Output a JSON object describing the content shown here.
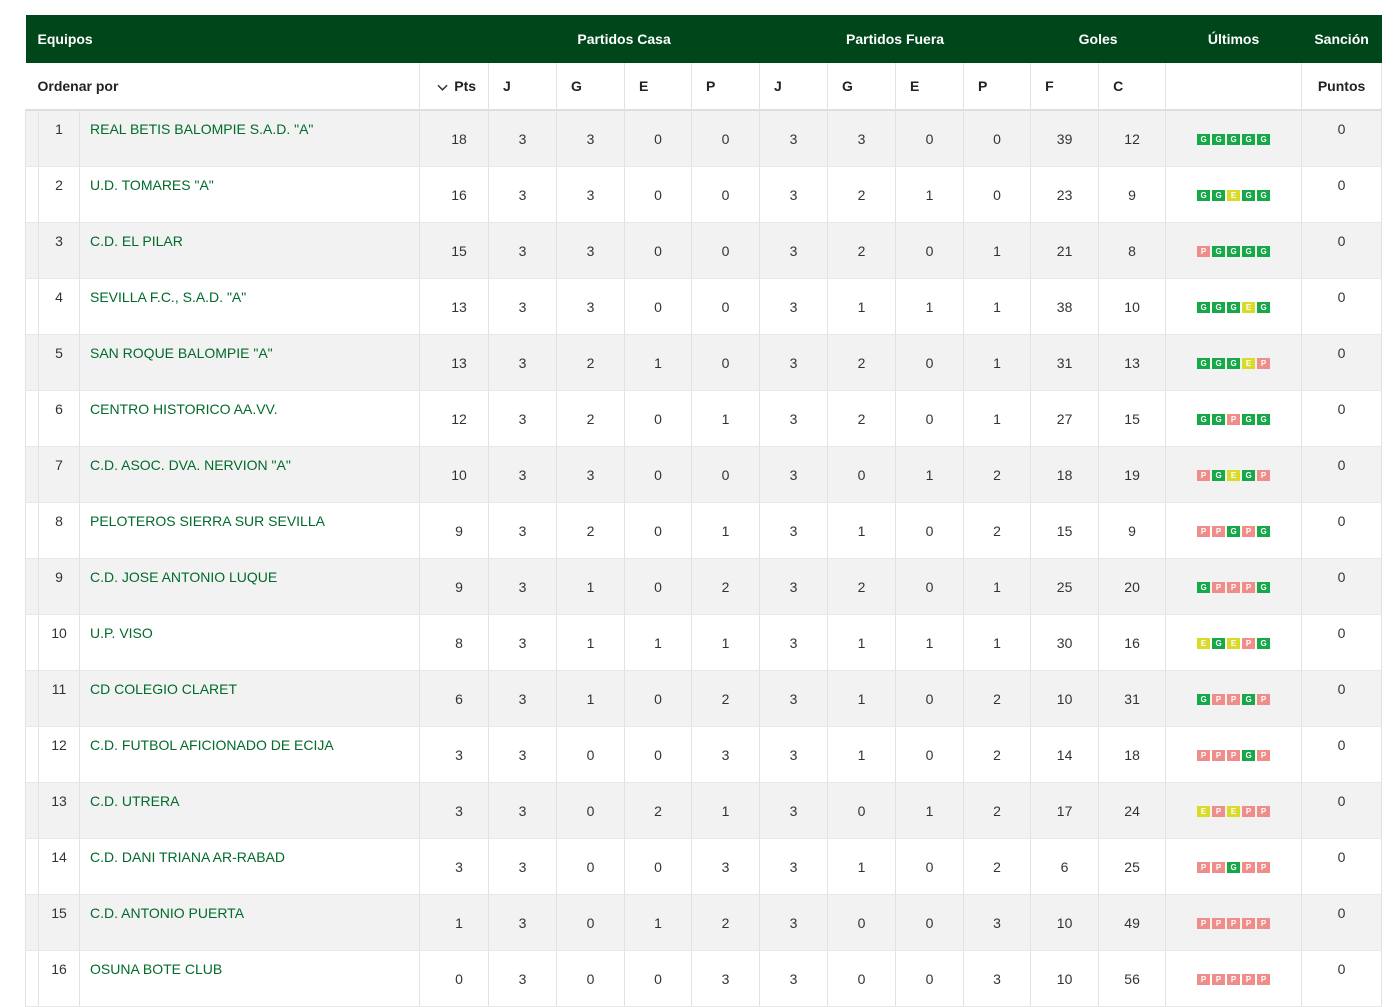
{
  "header": {
    "equipos": "Equipos",
    "partidos_casa": "Partidos Casa",
    "partidos_fuera": "Partidos Fuera",
    "goles": "Goles",
    "ultimos": "Últimos",
    "sancion": "Sanción"
  },
  "subheader": {
    "ordenar_por": "Ordenar por",
    "pts": "Pts",
    "home_j": "J",
    "home_g": "G",
    "home_e": "E",
    "home_p": "P",
    "away_j": "J",
    "away_g": "G",
    "away_e": "E",
    "away_p": "P",
    "goles_f": "F",
    "goles_c": "C",
    "puntos": "Puntos"
  },
  "colors": {
    "header_bg": "#00461b",
    "team_link": "#006b2a",
    "win": "#17a84a",
    "draw": "#d8db2a",
    "loss": "#ef8d8a"
  },
  "icons": {
    "sort": "chevron-down-icon"
  },
  "rows": [
    {
      "pos": "1",
      "team": "REAL BETIS BALOMPIE S.A.D. \"A\"",
      "pts": "18",
      "hj": "3",
      "hg": "3",
      "he": "0",
      "hp": "0",
      "aj": "3",
      "ag": "3",
      "ae": "0",
      "ap": "0",
      "gf": "39",
      "gc": "12",
      "form": [
        "G",
        "G",
        "G",
        "G",
        "G"
      ],
      "sancion": "0"
    },
    {
      "pos": "2",
      "team": "U.D. TOMARES \"A\"",
      "pts": "16",
      "hj": "3",
      "hg": "3",
      "he": "0",
      "hp": "0",
      "aj": "3",
      "ag": "2",
      "ae": "1",
      "ap": "0",
      "gf": "23",
      "gc": "9",
      "form": [
        "G",
        "G",
        "E",
        "G",
        "G"
      ],
      "sancion": "0"
    },
    {
      "pos": "3",
      "team": "C.D. EL PILAR",
      "pts": "15",
      "hj": "3",
      "hg": "3",
      "he": "0",
      "hp": "0",
      "aj": "3",
      "ag": "2",
      "ae": "0",
      "ap": "1",
      "gf": "21",
      "gc": "8",
      "form": [
        "P",
        "G",
        "G",
        "G",
        "G"
      ],
      "sancion": "0"
    },
    {
      "pos": "4",
      "team": "SEVILLA F.C., S.A.D. \"A\"",
      "pts": "13",
      "hj": "3",
      "hg": "3",
      "he": "0",
      "hp": "0",
      "aj": "3",
      "ag": "1",
      "ae": "1",
      "ap": "1",
      "gf": "38",
      "gc": "10",
      "form": [
        "G",
        "G",
        "G",
        "E",
        "G"
      ],
      "sancion": "0"
    },
    {
      "pos": "5",
      "team": "SAN ROQUE BALOMPIE \"A\"",
      "pts": "13",
      "hj": "3",
      "hg": "2",
      "he": "1",
      "hp": "0",
      "aj": "3",
      "ag": "2",
      "ae": "0",
      "ap": "1",
      "gf": "31",
      "gc": "13",
      "form": [
        "G",
        "G",
        "G",
        "E",
        "P"
      ],
      "sancion": "0"
    },
    {
      "pos": "6",
      "team": "CENTRO HISTORICO AA.VV.",
      "pts": "12",
      "hj": "3",
      "hg": "2",
      "he": "0",
      "hp": "1",
      "aj": "3",
      "ag": "2",
      "ae": "0",
      "ap": "1",
      "gf": "27",
      "gc": "15",
      "form": [
        "G",
        "G",
        "P",
        "G",
        "G"
      ],
      "sancion": "0"
    },
    {
      "pos": "7",
      "team": "C.D. ASOC. DVA. NERVION \"A\"",
      "pts": "10",
      "hj": "3",
      "hg": "3",
      "he": "0",
      "hp": "0",
      "aj": "3",
      "ag": "0",
      "ae": "1",
      "ap": "2",
      "gf": "18",
      "gc": "19",
      "form": [
        "P",
        "G",
        "E",
        "G",
        "P"
      ],
      "sancion": "0"
    },
    {
      "pos": "8",
      "team": "PELOTEROS SIERRA SUR SEVILLA",
      "pts": "9",
      "hj": "3",
      "hg": "2",
      "he": "0",
      "hp": "1",
      "aj": "3",
      "ag": "1",
      "ae": "0",
      "ap": "2",
      "gf": "15",
      "gc": "9",
      "form": [
        "P",
        "P",
        "G",
        "P",
        "G"
      ],
      "sancion": "0"
    },
    {
      "pos": "9",
      "team": "C.D. JOSE ANTONIO LUQUE",
      "pts": "9",
      "hj": "3",
      "hg": "1",
      "he": "0",
      "hp": "2",
      "aj": "3",
      "ag": "2",
      "ae": "0",
      "ap": "1",
      "gf": "25",
      "gc": "20",
      "form": [
        "G",
        "P",
        "P",
        "P",
        "G"
      ],
      "sancion": "0"
    },
    {
      "pos": "10",
      "team": "U.P. VISO",
      "pts": "8",
      "hj": "3",
      "hg": "1",
      "he": "1",
      "hp": "1",
      "aj": "3",
      "ag": "1",
      "ae": "1",
      "ap": "1",
      "gf": "30",
      "gc": "16",
      "form": [
        "E",
        "G",
        "E",
        "P",
        "G"
      ],
      "sancion": "0"
    },
    {
      "pos": "11",
      "team": "CD COLEGIO CLARET",
      "pts": "6",
      "hj": "3",
      "hg": "1",
      "he": "0",
      "hp": "2",
      "aj": "3",
      "ag": "1",
      "ae": "0",
      "ap": "2",
      "gf": "10",
      "gc": "31",
      "form": [
        "G",
        "P",
        "P",
        "G",
        "P"
      ],
      "sancion": "0"
    },
    {
      "pos": "12",
      "team": "C.D. FUTBOL AFICIONADO DE ECIJA",
      "pts": "3",
      "hj": "3",
      "hg": "0",
      "he": "0",
      "hp": "3",
      "aj": "3",
      "ag": "1",
      "ae": "0",
      "ap": "2",
      "gf": "14",
      "gc": "18",
      "form": [
        "P",
        "P",
        "P",
        "G",
        "P"
      ],
      "sancion": "0"
    },
    {
      "pos": "13",
      "team": "C.D. UTRERA",
      "pts": "3",
      "hj": "3",
      "hg": "0",
      "he": "2",
      "hp": "1",
      "aj": "3",
      "ag": "0",
      "ae": "1",
      "ap": "2",
      "gf": "17",
      "gc": "24",
      "form": [
        "E",
        "P",
        "E",
        "P",
        "P"
      ],
      "sancion": "0"
    },
    {
      "pos": "14",
      "team": "C.D. DANI TRIANA AR-RABAD",
      "pts": "3",
      "hj": "3",
      "hg": "0",
      "he": "0",
      "hp": "3",
      "aj": "3",
      "ag": "1",
      "ae": "0",
      "ap": "2",
      "gf": "6",
      "gc": "25",
      "form": [
        "P",
        "P",
        "G",
        "P",
        "P"
      ],
      "sancion": "0"
    },
    {
      "pos": "15",
      "team": "C.D. ANTONIO PUERTA",
      "pts": "1",
      "hj": "3",
      "hg": "0",
      "he": "1",
      "hp": "2",
      "aj": "3",
      "ag": "0",
      "ae": "0",
      "ap": "3",
      "gf": "10",
      "gc": "49",
      "form": [
        "P",
        "P",
        "P",
        "P",
        "P"
      ],
      "sancion": "0"
    },
    {
      "pos": "16",
      "team": "OSUNA BOTE CLUB",
      "pts": "0",
      "hj": "3",
      "hg": "0",
      "he": "0",
      "hp": "3",
      "aj": "3",
      "ag": "0",
      "ae": "0",
      "ap": "3",
      "gf": "10",
      "gc": "56",
      "form": [
        "P",
        "P",
        "P",
        "P",
        "P"
      ],
      "sancion": "0"
    }
  ]
}
